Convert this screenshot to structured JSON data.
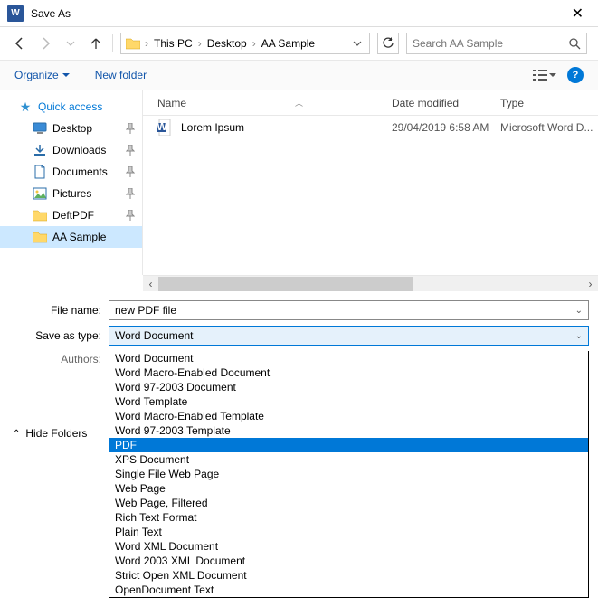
{
  "titlebar": {
    "title": "Save As"
  },
  "breadcrumb": {
    "items": [
      "This PC",
      "Desktop",
      "AA Sample"
    ]
  },
  "search": {
    "placeholder": "Search AA Sample"
  },
  "toolbar": {
    "organize": "Organize",
    "newfolder": "New folder"
  },
  "sidebar": {
    "quick": "Quick access",
    "items": [
      {
        "label": "Desktop",
        "pinned": true
      },
      {
        "label": "Downloads",
        "pinned": true
      },
      {
        "label": "Documents",
        "pinned": true
      },
      {
        "label": "Pictures",
        "pinned": true
      },
      {
        "label": "DeftPDF",
        "pinned": true
      },
      {
        "label": "AA Sample",
        "pinned": false,
        "selected": true
      }
    ]
  },
  "columns": {
    "name": "Name",
    "date": "Date modified",
    "type": "Type"
  },
  "files": [
    {
      "name": "Lorem Ipsum",
      "date": "29/04/2019 6:58 AM",
      "type": "Microsoft Word D..."
    }
  ],
  "form": {
    "filename_label": "File name:",
    "filename_value": "new PDF file",
    "saveastype_label": "Save as type:",
    "saveastype_value": "Word Document",
    "authors_label": "Authors:"
  },
  "filetypes": [
    "Word Document",
    "Word Macro-Enabled Document",
    "Word 97-2003 Document",
    "Word Template",
    "Word Macro-Enabled Template",
    "Word 97-2003 Template",
    "PDF",
    "XPS Document",
    "Single File Web Page",
    "Web Page",
    "Web Page, Filtered",
    "Rich Text Format",
    "Plain Text",
    "Word XML Document",
    "Word 2003 XML Document",
    "Strict Open XML Document",
    "OpenDocument Text"
  ],
  "filetypes_selected_index": 6,
  "hide_folders": "Hide Folders"
}
